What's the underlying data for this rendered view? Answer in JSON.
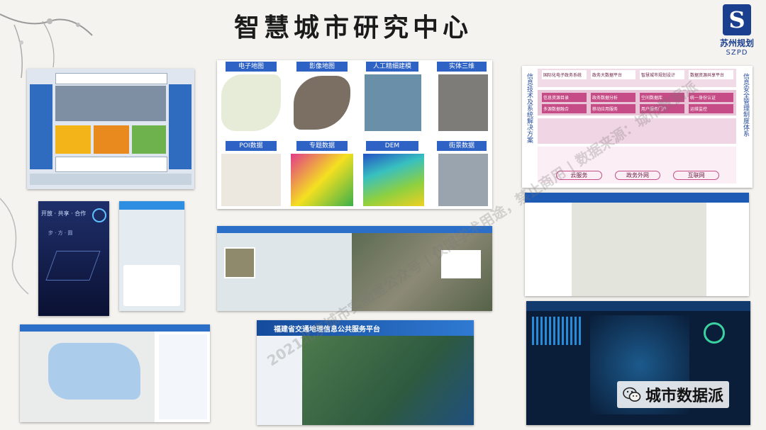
{
  "title": "智慧城市研究中心",
  "logo": {
    "letter": "S",
    "cn": "苏州规划",
    "en": "SZPD"
  },
  "tiles": [
    "电子地图",
    "影像地图",
    "人工精细建模",
    "实体三维",
    "POI数据",
    "专题数据",
    "DEM",
    "街景数据"
  ],
  "phone_app": {
    "tagline": "开放 · 共享 · 合作",
    "subtitle": "步 · 方 · 圆"
  },
  "bottom_center_title": "福建省交通地理信息公共服务平台",
  "watermark": "2021北京城市实验室公众号 | 仅限学术用途，禁止商用 | 数据来源：城市数据派",
  "badge": {
    "label": "城市数据派"
  },
  "right_diagram": {
    "left_label": "信息技术及系统解决方案",
    "right_label": "信息安全管理制度体系",
    "rows": [
      [
        "国际化电子政务系统",
        "政务大数据平台",
        "智慧城市规划设计",
        "数据资源共享平台"
      ],
      [
        "信息资源目录",
        "政务数据分析",
        "空间数据库",
        "统一身份认证"
      ],
      [
        "多源数据融合",
        "移动应用服务",
        "用户服务门户",
        "运维监控"
      ]
    ],
    "bottom": [
      "云服务",
      "政务外网",
      "互联网"
    ]
  }
}
